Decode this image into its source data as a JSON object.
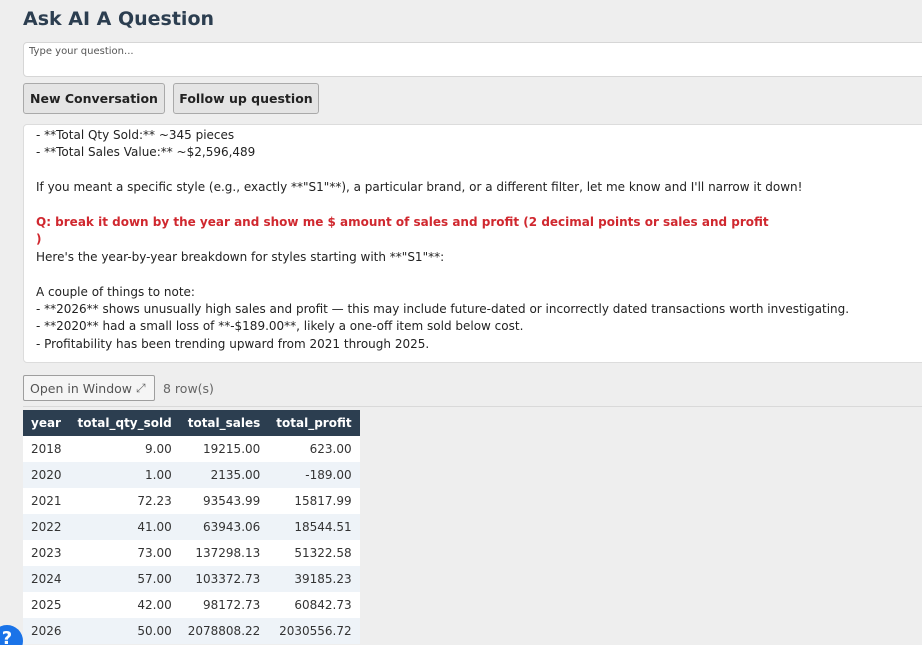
{
  "header": {
    "title": "Ask AI A Question"
  },
  "question_input": {
    "placeholder": "Type your question..."
  },
  "buttons": {
    "new_conversation": "New Conversation",
    "follow_up": "Follow up question"
  },
  "conversation": {
    "lines": [
      {
        "type": "text",
        "text": "- **Total Qty Sold:** ~345 pieces"
      },
      {
        "type": "text",
        "text": "- **Total Sales Value:** ~$2,596,489"
      },
      {
        "type": "text",
        "text": ""
      },
      {
        "type": "text",
        "text": "If you meant a specific style (e.g., exactly **\"S1\"**), a particular brand, or a different filter, let me know and I'll narrow it down!"
      },
      {
        "type": "text",
        "text": ""
      },
      {
        "type": "question",
        "text": "Q:  break it down by the year and show me $ amount of sales and profit (2 decimal points or sales and profit"
      },
      {
        "type": "question",
        "text": ")"
      },
      {
        "type": "text",
        "text": "Here's the year-by-year breakdown for styles starting with **\"S1\"**:"
      },
      {
        "type": "text",
        "text": ""
      },
      {
        "type": "text",
        "text": "A couple of things to note:"
      },
      {
        "type": "text",
        "text": "- **2026** shows unusually high sales and profit — this may include future-dated or incorrectly dated transactions worth investigating."
      },
      {
        "type": "text",
        "text": "- **2020** had a small loss of **-$189.00**, likely a one-off item sold below cost."
      },
      {
        "type": "text",
        "text": "- Profitability has been trending upward from 2021 through 2025."
      }
    ]
  },
  "results": {
    "open_window_label": "Open in Window",
    "open_window_icon": "expand-arrows-icon",
    "row_count": "8 row(s)",
    "columns": [
      "year",
      "total_qty_sold",
      "total_sales",
      "total_profit"
    ],
    "rows": [
      [
        "2018",
        "9.00",
        "19215.00",
        "623.00"
      ],
      [
        "2020",
        "1.00",
        "2135.00",
        "-189.00"
      ],
      [
        "2021",
        "72.23",
        "93543.99",
        "15817.99"
      ],
      [
        "2022",
        "41.00",
        "63943.06",
        "18544.51"
      ],
      [
        "2023",
        "73.00",
        "137298.13",
        "51322.58"
      ],
      [
        "2024",
        "57.00",
        "103372.73",
        "39185.23"
      ],
      [
        "2025",
        "42.00",
        "98172.73",
        "60842.73"
      ],
      [
        "2026",
        "50.00",
        "2078808.22",
        "2030556.72"
      ]
    ]
  },
  "help": {
    "label": "?"
  },
  "colors": {
    "header_bg": "#2c3e50",
    "question_red": "#d0282f",
    "help_blue": "#1a73e8"
  }
}
